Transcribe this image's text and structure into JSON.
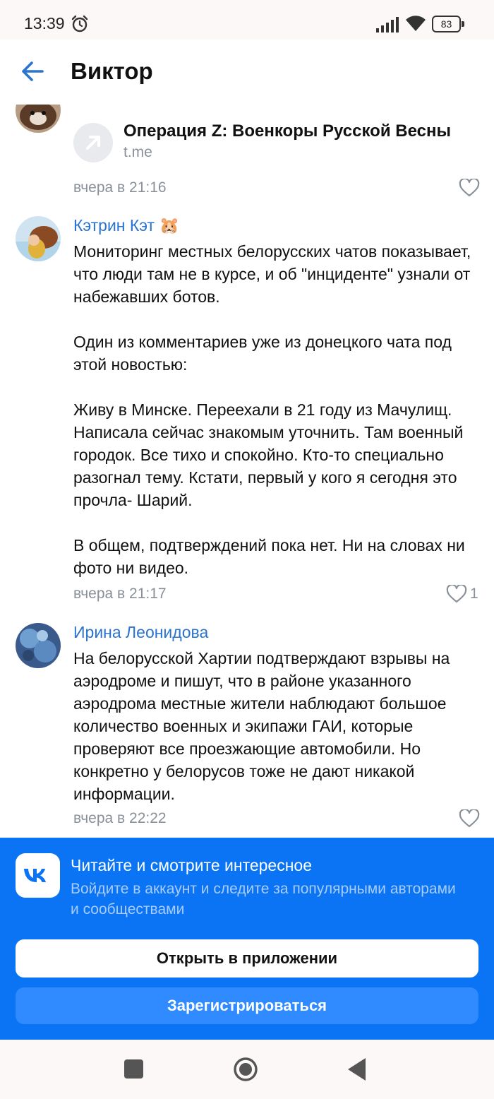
{
  "status_bar": {
    "time": "13:39",
    "battery": "83",
    "icons": [
      "alarm-icon",
      "signal-icon",
      "wifi-icon",
      "battery-icon"
    ]
  },
  "header": {
    "title": "Виктор",
    "back_icon": "arrow-left-icon"
  },
  "link_post": {
    "title": "Операция Z: Военкоры Русской Весны",
    "domain": "t.me",
    "time": "вчера в 21:16",
    "icon": "external-link-arrow-icon"
  },
  "comments": [
    {
      "author": "Кэтрин Кэт 🐹",
      "text": "Мониторинг местных белорусских чатов показывает, что люди там не в курсе, и об \"инциденте\" узнали от набежавших ботов.\n\nОдин из комментариев уже из донецкого чата под этой новостью:\n\nЖиву в Минске. Переехали в 21 году из Мачулищ. Написала сейчас знакомым уточнить. Там военный городок. Все тихо и спокойно. Кто-то специально разогнал тему. Кстати, первый у кого я сегодня это прочла- Шарий.\n\nВ общем, подтверждений пока нет. Ни на словах ни фото ни видео.",
      "time": "вчера в 21:17",
      "likes": "1"
    },
    {
      "author": "Ирина Леонидова",
      "text": "На белорусской Хартии подтверждают взрывы на аэродроме и пишут, что в районе указанного аэродрома местные жители наблюдают большое количество военных и экипажи ГАИ, которые проверяют все проезжающие автомобили. Но конкретно у белорусов тоже не дают никакой информации.",
      "time": "вчера в 22:22",
      "likes": ""
    }
  ],
  "vk_banner": {
    "title": "Читайте и смотрите интересное",
    "subtitle": "Войдите в аккаунт и следите за популярными авторами и сообществами",
    "open_button": "Открыть в приложении",
    "register_button": "Зарегистрироваться",
    "brand_color": "#0a74f4"
  },
  "colors": {
    "author": "#2a74cf",
    "meta": "#8a9099",
    "primary": "#0a74f4"
  }
}
